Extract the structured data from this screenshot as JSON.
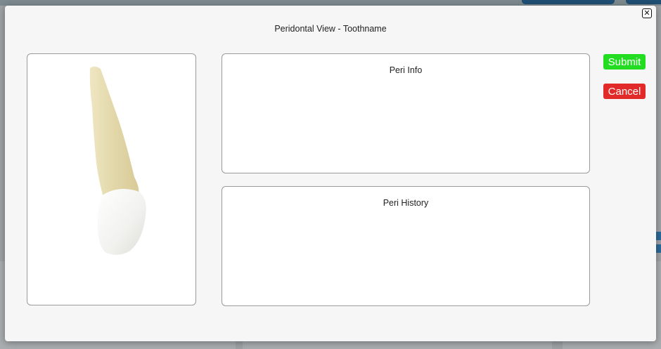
{
  "modal": {
    "title": "Peridontal View - Toothname",
    "close_symbol": "✕"
  },
  "tooth_image": {
    "icon": "tooth-icon",
    "crown_color": "#f1f1ee",
    "root_color": "#e6ddb4"
  },
  "cards": {
    "peri_info": {
      "title": "Peri Info"
    },
    "peri_history": {
      "title": "Peri History"
    }
  },
  "actions": {
    "submit_label": "Submit",
    "cancel_label": "Cancel",
    "submit_color": "#22dd22",
    "cancel_color": "#e22a2a"
  }
}
